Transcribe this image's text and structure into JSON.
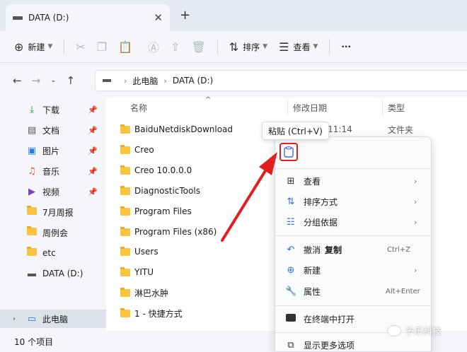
{
  "window": {
    "tab_title": "DATA (D:)",
    "tab_close": "✕",
    "new_tab": "+"
  },
  "toolbar": {
    "new_label": "新建",
    "sort_label": "排序",
    "view_label": "查看",
    "more_label": "···"
  },
  "address": {
    "crumbs": [
      "此电脑",
      "DATA (D:)"
    ]
  },
  "sidebar": {
    "items": [
      {
        "label": "下载",
        "icon": "download-icon"
      },
      {
        "label": "文档",
        "icon": "document-icon"
      },
      {
        "label": "图片",
        "icon": "picture-icon"
      },
      {
        "label": "音乐",
        "icon": "music-icon"
      },
      {
        "label": "视频",
        "icon": "video-icon"
      },
      {
        "label": "7月周报",
        "icon": "folder-icon"
      },
      {
        "label": "周例会",
        "icon": "folder-icon"
      },
      {
        "label": "etc",
        "icon": "folder-icon"
      },
      {
        "label": "DATA (D:)",
        "icon": "drive-icon"
      },
      {
        "label": "此电脑",
        "icon": "computer-icon"
      }
    ]
  },
  "columns": {
    "name": "名称",
    "date": "修改日期",
    "type": "类型"
  },
  "files": [
    {
      "name": "BaiduNetdiskDownload",
      "date": "/14 11:14",
      "type": "文件夹"
    },
    {
      "name": "Creo"
    },
    {
      "name": "Creo 10.0.0.0"
    },
    {
      "name": "DiagnosticTools"
    },
    {
      "name": "Program Files"
    },
    {
      "name": "Program Files (x86)"
    },
    {
      "name": "Users"
    },
    {
      "name": "YITU"
    },
    {
      "name": "淋巴水肿"
    },
    {
      "name": "1 - 快捷方式"
    }
  ],
  "status": {
    "count": "10 个项目"
  },
  "tooltip": {
    "text": "粘贴 (Ctrl+V)"
  },
  "context_menu": {
    "items": [
      {
        "label": "查看"
      },
      {
        "label": "排序方式"
      },
      {
        "label": "分组依据"
      },
      {
        "label": "撤消",
        "extra": "复制",
        "shortcut": "Ctrl+Z"
      },
      {
        "label": "新建"
      },
      {
        "label": "属性",
        "shortcut": "Alt+Enter"
      },
      {
        "label": "在终端中打开"
      },
      {
        "label": "显示更多选项"
      }
    ]
  },
  "watermark": {
    "text": "予乐科技"
  },
  "colors": {
    "accent": "#3b6fc4",
    "highlight_red": "#e02020",
    "folder": "#f7c443"
  }
}
